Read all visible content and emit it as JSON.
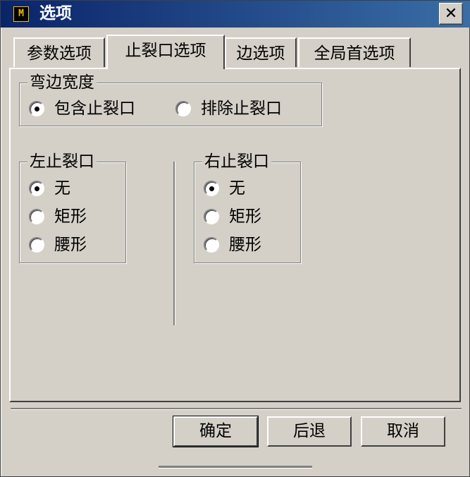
{
  "window": {
    "title": "选项",
    "close_glyph": "✕"
  },
  "tabs": [
    {
      "label": "参数选项",
      "active": false
    },
    {
      "label": "止裂口选项",
      "active": true
    },
    {
      "label": "边选项",
      "active": false
    },
    {
      "label": "全局首选项",
      "active": false
    }
  ],
  "bend_width": {
    "legend": "弯边宽度",
    "options": [
      {
        "label": "包含止裂口",
        "checked": true
      },
      {
        "label": "排除止裂口",
        "checked": false
      }
    ]
  },
  "left_relief": {
    "legend": "左止裂口",
    "options": [
      {
        "label": "无",
        "checked": true
      },
      {
        "label": "矩形",
        "checked": false
      },
      {
        "label": "腰形",
        "checked": false
      }
    ]
  },
  "right_relief": {
    "legend": "右止裂口",
    "options": [
      {
        "label": "无",
        "checked": true
      },
      {
        "label": "矩形",
        "checked": false
      },
      {
        "label": "腰形",
        "checked": false
      }
    ]
  },
  "buttons": {
    "ok": "确定",
    "back": "后退",
    "cancel": "取消"
  }
}
